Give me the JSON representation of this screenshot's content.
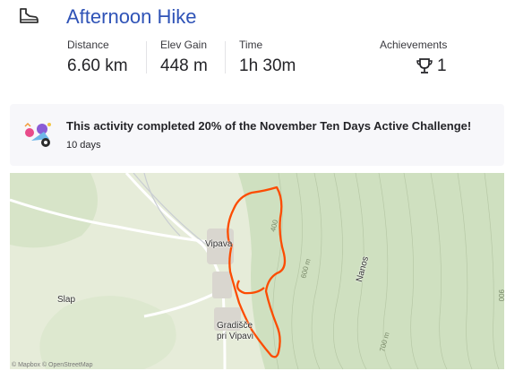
{
  "activity": {
    "title": "Afternoon Hike",
    "icon": "hiking-boot-icon"
  },
  "stats": [
    {
      "label": "Distance",
      "value": "6.60 km"
    },
    {
      "label": "Elev Gain",
      "value": "448 m"
    },
    {
      "label": "Time",
      "value": "1h 30m"
    }
  ],
  "achievements": {
    "label": "Achievements",
    "count": "1",
    "icon": "trophy-icon"
  },
  "challenge": {
    "text": "This activity completed 20% of the November Ten Days Active Challenge!",
    "subtext": "10 days",
    "icon": "challenge-badge-icon"
  },
  "map": {
    "places": [
      "Vipava",
      "Slap",
      "Gradišče",
      "pri Vipavi",
      "Nanos"
    ],
    "contours": [
      "400",
      "600 m",
      "700 m",
      "900"
    ],
    "attribution": "© Mapbox © OpenStreetMap",
    "route_color": "#fc4c02",
    "title_color": "#2f53b7"
  }
}
